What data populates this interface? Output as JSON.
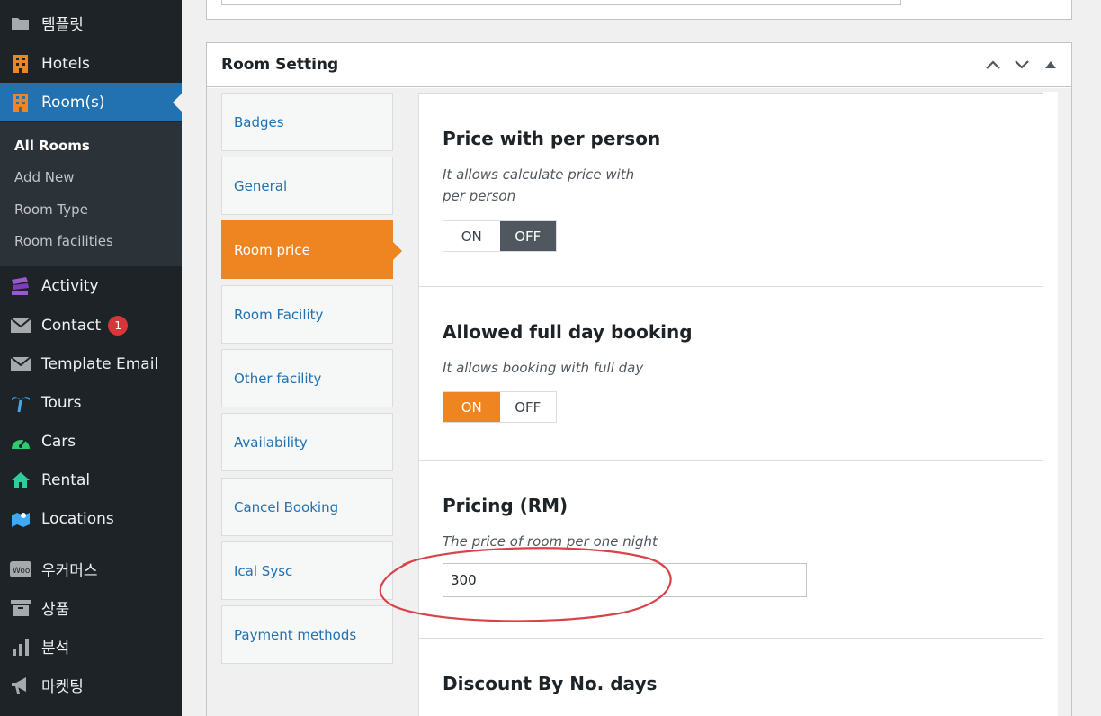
{
  "sidebar": {
    "items": [
      {
        "label": "템플릿",
        "icon": "folder-icon",
        "active": false
      },
      {
        "label": "Hotels",
        "icon": "building-icon",
        "active": false
      },
      {
        "label": "Room(s)",
        "icon": "building-icon",
        "active": true
      },
      {
        "label": "Activity",
        "icon": "activity-icon",
        "active": false
      },
      {
        "label": "Contact",
        "icon": "mail-icon",
        "badge": "1"
      },
      {
        "label": "Template Email",
        "icon": "mail-icon"
      },
      {
        "label": "Tours",
        "icon": "palm-tree-icon"
      },
      {
        "label": "Cars",
        "icon": "dashboard-icon"
      },
      {
        "label": "Rental",
        "icon": "home-icon"
      },
      {
        "label": "Locations",
        "icon": "map-icon"
      },
      {
        "label": "우커머스",
        "icon": "woo-icon"
      },
      {
        "label": "상품",
        "icon": "archive-icon"
      },
      {
        "label": "분석",
        "icon": "bar-chart-icon"
      },
      {
        "label": "마켓팅",
        "icon": "megaphone-icon"
      }
    ],
    "submenu": [
      "All Rooms",
      "Add New",
      "Room Type",
      "Room facilities"
    ]
  },
  "panel": {
    "title": "Room Setting",
    "tabs": [
      "Badges",
      "General",
      "Room price",
      "Room Facility",
      "Other facility",
      "Availability",
      "Cancel Booking",
      "Ical Sysc",
      "Payment methods"
    ],
    "active_tab": "Room price"
  },
  "sections": {
    "per_person": {
      "title": "Price with per person",
      "desc_line1": "It allows calculate price with",
      "desc_line2": "per person",
      "on": "ON",
      "off": "OFF",
      "state": "OFF"
    },
    "full_day": {
      "title": "Allowed full day booking",
      "desc": "It allows booking with full day",
      "on": "ON",
      "off": "OFF",
      "state": "ON"
    },
    "pricing": {
      "title": "Pricing (RM)",
      "desc": "The price of room per one night",
      "value": "300"
    },
    "discount": {
      "title": "Discount By No. days"
    }
  },
  "colors": {
    "accent_orange": "#ee8521",
    "wp_blue": "#2271b1",
    "annotation_red": "#d8434a"
  }
}
